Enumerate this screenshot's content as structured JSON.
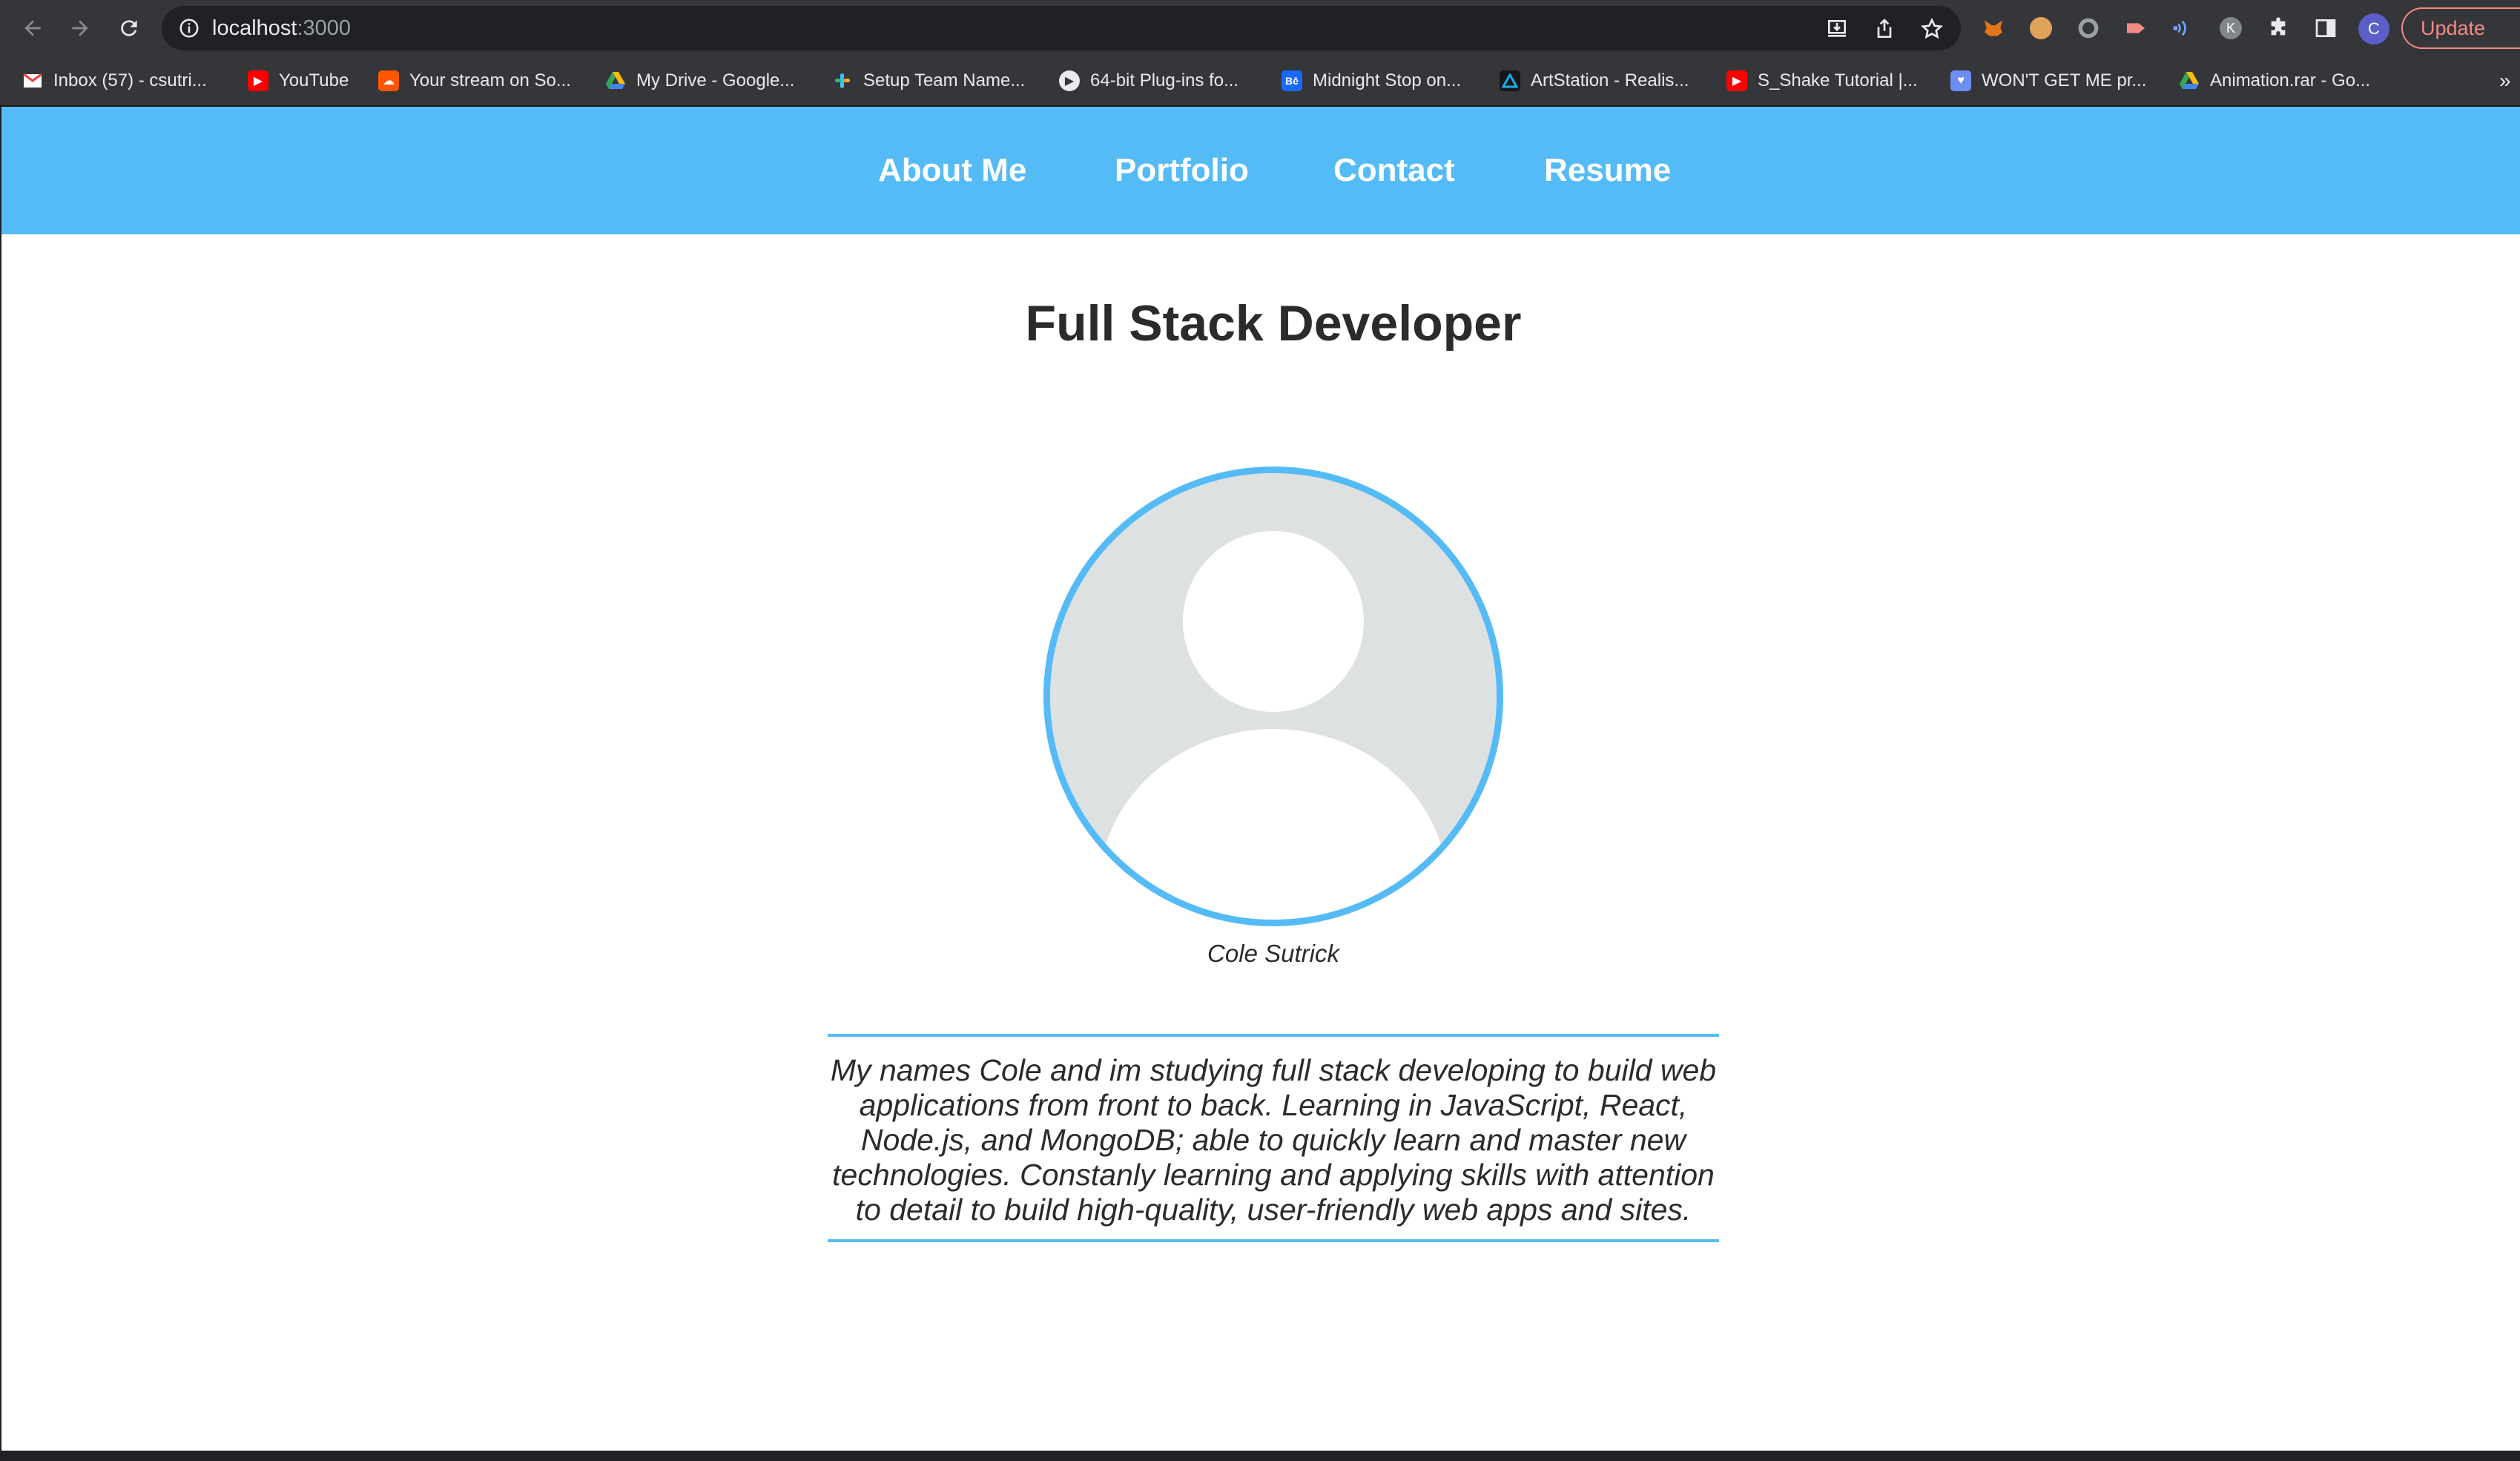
{
  "browser": {
    "url_host": "localhost",
    "url_port": ":3000",
    "update_label": "Update",
    "profile_initial": "C",
    "extension_k_initial": "K",
    "bookmarks_overflow": "»",
    "bookmarks": [
      {
        "label": "Inbox (57) - csutri...",
        "icon": "gmail-icon",
        "color": "#ea4335"
      },
      {
        "label": "YouTube",
        "icon": "youtube-icon",
        "color": "#ff0000"
      },
      {
        "label": "Your stream on So...",
        "icon": "soundcloud-icon",
        "color": "#ff5500"
      },
      {
        "label": "My Drive - Google...",
        "icon": "google-drive-icon",
        "color": "#34a853"
      },
      {
        "label": "Setup Team Name...",
        "icon": "slack-icon",
        "color": "#e01e5a"
      },
      {
        "label": "64-bit Plug-ins fo...",
        "icon": "play-icon",
        "color": "#9aa0a6"
      },
      {
        "label": "Midnight Stop on...",
        "icon": "behance-icon",
        "color": "#1769ff"
      },
      {
        "label": "ArtStation - Realis...",
        "icon": "artstation-icon",
        "color": "#13aff0"
      },
      {
        "label": "S_Shake Tutorial |...",
        "icon": "youtube-icon",
        "color": "#ff0000"
      },
      {
        "label": "WON'T GET ME pr...",
        "icon": "shield-icon",
        "color": "#6c8ef5"
      },
      {
        "label": "Animation.rar - Go...",
        "icon": "google-drive-icon",
        "color": "#34a853"
      }
    ]
  },
  "site": {
    "nav": [
      {
        "label": "About Me"
      },
      {
        "label": "Portfolio"
      },
      {
        "label": "Contact"
      },
      {
        "label": "Resume"
      }
    ],
    "title": "Full Stack Developer",
    "photo_caption": "Cole Sutrick",
    "bio": "My names Cole and im studying full stack developing to build web applications from front to back. Learning in JavaScript, React, Node.js, and MongoDB; able to quickly learn and master new technologies. Constanly learning and applying skills with attention to detail to build high-quality, user-friendly web apps and sites.",
    "accent_color": "#55bbf6",
    "text_color": "#2b2b2b"
  }
}
